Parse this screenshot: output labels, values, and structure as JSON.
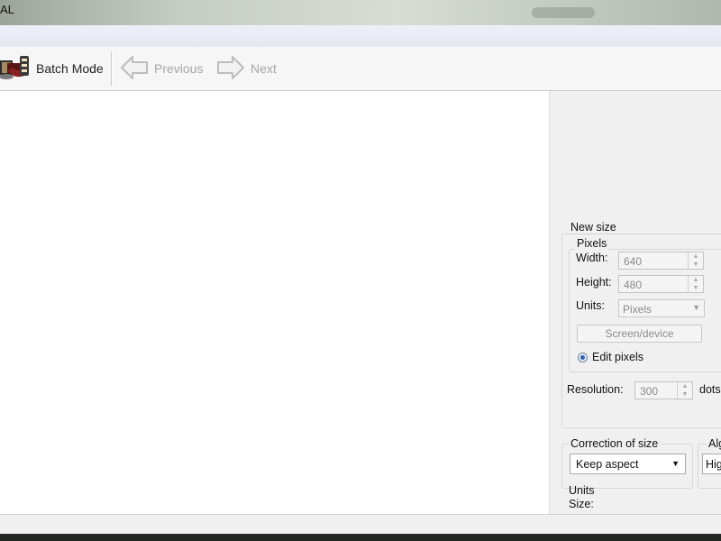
{
  "window": {
    "title": "AL"
  },
  "toolbar": {
    "batch_mode_label": "Batch Mode",
    "previous_label": "Previous",
    "next_label": "Next"
  },
  "new_size": {
    "group_label": "New size",
    "pixels_label": "Pixels",
    "width_label": "Width:",
    "width_value": "640",
    "height_label": "Height:",
    "height_value": "480",
    "units_label": "Units:",
    "units_value": "Pixels",
    "screen_device_label": "Screen/device",
    "edit_pixels_label": "Edit pixels",
    "resolution_label": "Resolution:",
    "resolution_value": "300",
    "resolution_unit": "dots"
  },
  "correction": {
    "label": "Correction of size",
    "value": "Keep aspect"
  },
  "algorithm": {
    "label": "Alg",
    "value": "Hig"
  },
  "bottom": {
    "units_label": "Units",
    "size_label": "Size:"
  }
}
